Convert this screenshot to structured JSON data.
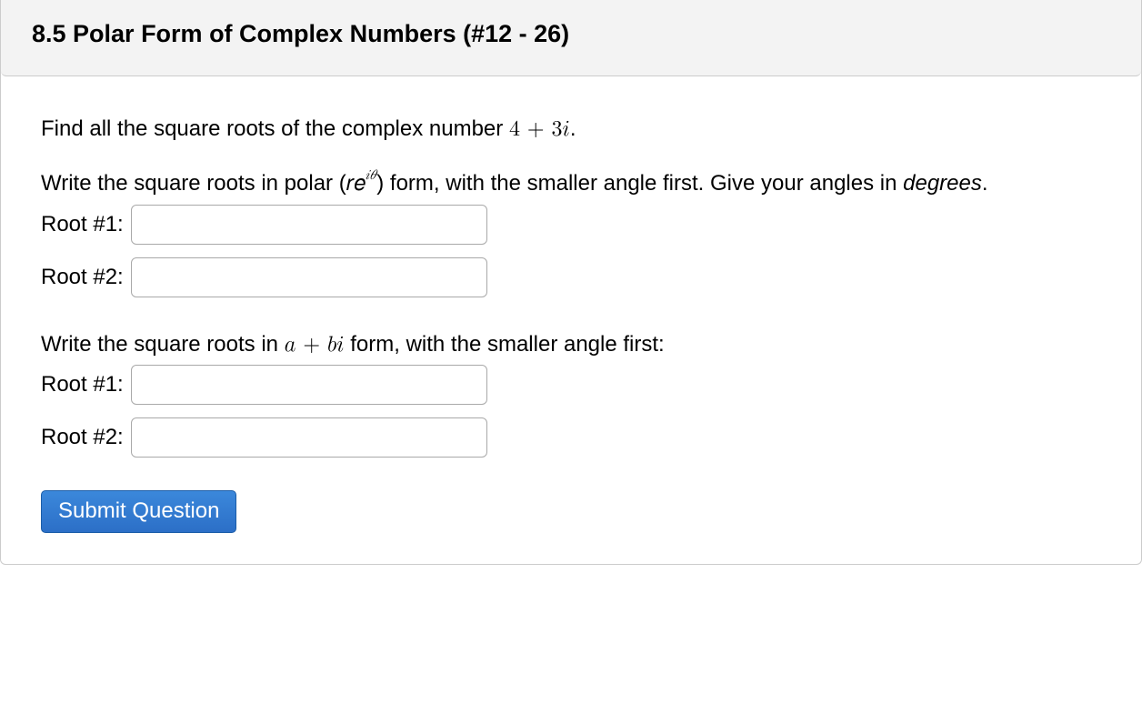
{
  "header": {
    "title": "8.5 Polar Form of Complex Numbers (#12 - 26)"
  },
  "question": {
    "prompt_prefix": "Find all the square roots of the complex number ",
    "complex_number": "4 + 3𝑖",
    "prompt_suffix": ".",
    "polar_instruction_pre": "Write the square roots in polar (𝑟𝑒",
    "polar_instruction_exp": "𝑖𝜃",
    "polar_instruction_post": ") form, with the smaller angle first. Give your angles in ",
    "polar_instruction_emph": "degrees",
    "polar_instruction_end": ".",
    "root1_label": "Root #1:",
    "root2_label": "Root #2:",
    "abi_instruction_pre": "Write the square roots in ",
    "abi_expr": "𝑎 + 𝑏𝑖",
    "abi_instruction_post": " form, with the smaller angle first:",
    "inputs": {
      "polar_root1": "",
      "polar_root2": "",
      "abi_root1": "",
      "abi_root2": ""
    }
  },
  "actions": {
    "submit_label": "Submit Question"
  }
}
